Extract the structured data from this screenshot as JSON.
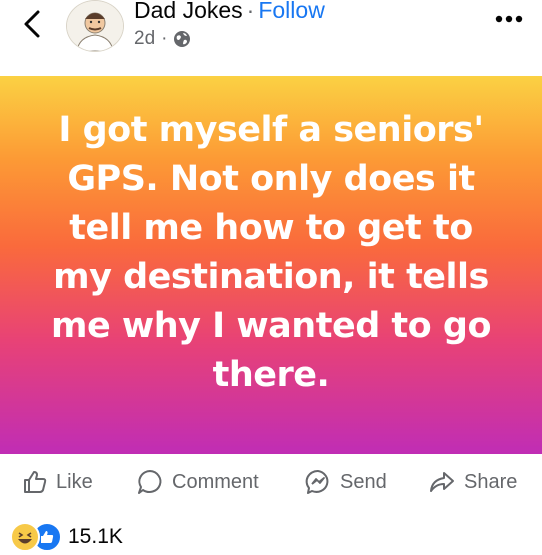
{
  "header": {
    "page_name": "Dad Jokes",
    "separator": "·",
    "follow_label": "Follow",
    "post_age": "2d",
    "meta_separator": "·",
    "privacy_icon": "globe-icon"
  },
  "post": {
    "text": "I got myself a seniors' GPS. Not only does it tell me how to get to my destination, it tells me why I wanted to go there.",
    "colors": {
      "top": "#fbd143",
      "middle": "#fa6a3c",
      "bottom": "#c02db5"
    }
  },
  "actions": {
    "like": "Like",
    "comment": "Comment",
    "send": "Send",
    "share": "Share"
  },
  "reactions": {
    "icons": [
      "haha-reaction-icon",
      "like-reaction-icon"
    ],
    "count": "15.1K"
  }
}
